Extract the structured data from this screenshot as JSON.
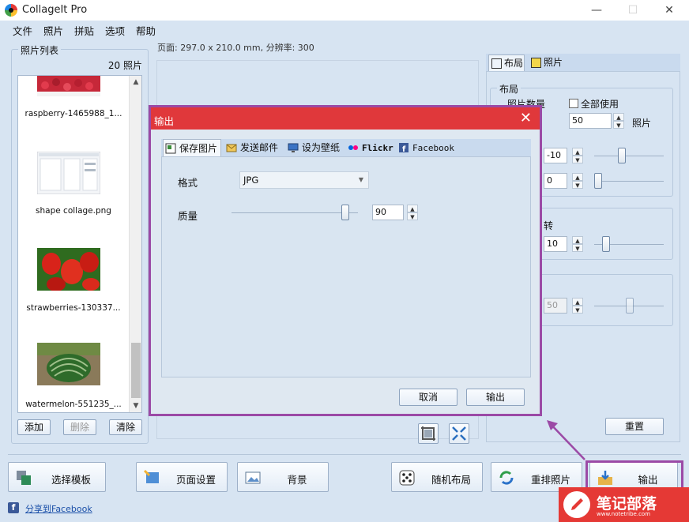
{
  "window": {
    "title": "CollageIt Pro",
    "minimize": "—",
    "maximize": "☐",
    "close": "✕"
  },
  "menu": [
    "文件",
    "照片",
    "拼贴",
    "选项",
    "帮助"
  ],
  "page_info": "页面: 297.0 x 210.0 mm, 分辨率: 300",
  "photo_list": {
    "title": "照片列表",
    "count": "20 照片",
    "items": [
      {
        "label": "raspberry-1465988_1...",
        "icon": "raspberry-photo"
      },
      {
        "label": "shape collage.png",
        "icon": "screenshot-photo"
      },
      {
        "label": "strawberries-130337...",
        "icon": "strawberry-photo"
      },
      {
        "label": "watermelon-551235_...",
        "icon": "watermelon-photo"
      }
    ],
    "add": "添加",
    "delete": "删除",
    "clear": "清除"
  },
  "bottom_buttons": [
    "选择模板",
    "页面设置",
    "背景",
    "随机布局",
    "重排照片",
    "输出"
  ],
  "share": "分享到Facebook",
  "right_panel": {
    "tabs": [
      "布局",
      "照片"
    ],
    "layout_group": "布局",
    "photo_count_label": "照片数量",
    "use_all": "全部使用",
    "photo_count": "50",
    "photo_unit": "照片",
    "val1": "-10",
    "val2": "0",
    "partial_label": "转",
    "val3": "10",
    "val4": "50",
    "reset": "重置"
  },
  "dialog": {
    "title": "输出",
    "close": "✕",
    "tabs": [
      "保存图片",
      "发送邮件",
      "设为壁纸",
      "Flickr",
      "Facebook"
    ],
    "format_label": "格式",
    "format_value": "JPG",
    "quality_label": "质量",
    "quality_value": "90",
    "quality_level": 0.9,
    "cancel": "取消",
    "output": "输出"
  },
  "watermark": {
    "text": "笔记部落",
    "sub": "www.notetribe.com"
  },
  "colors": {
    "accent": "#9b4aa6",
    "dialog_title": "#e0383b",
    "background": "#d7e4f2"
  }
}
